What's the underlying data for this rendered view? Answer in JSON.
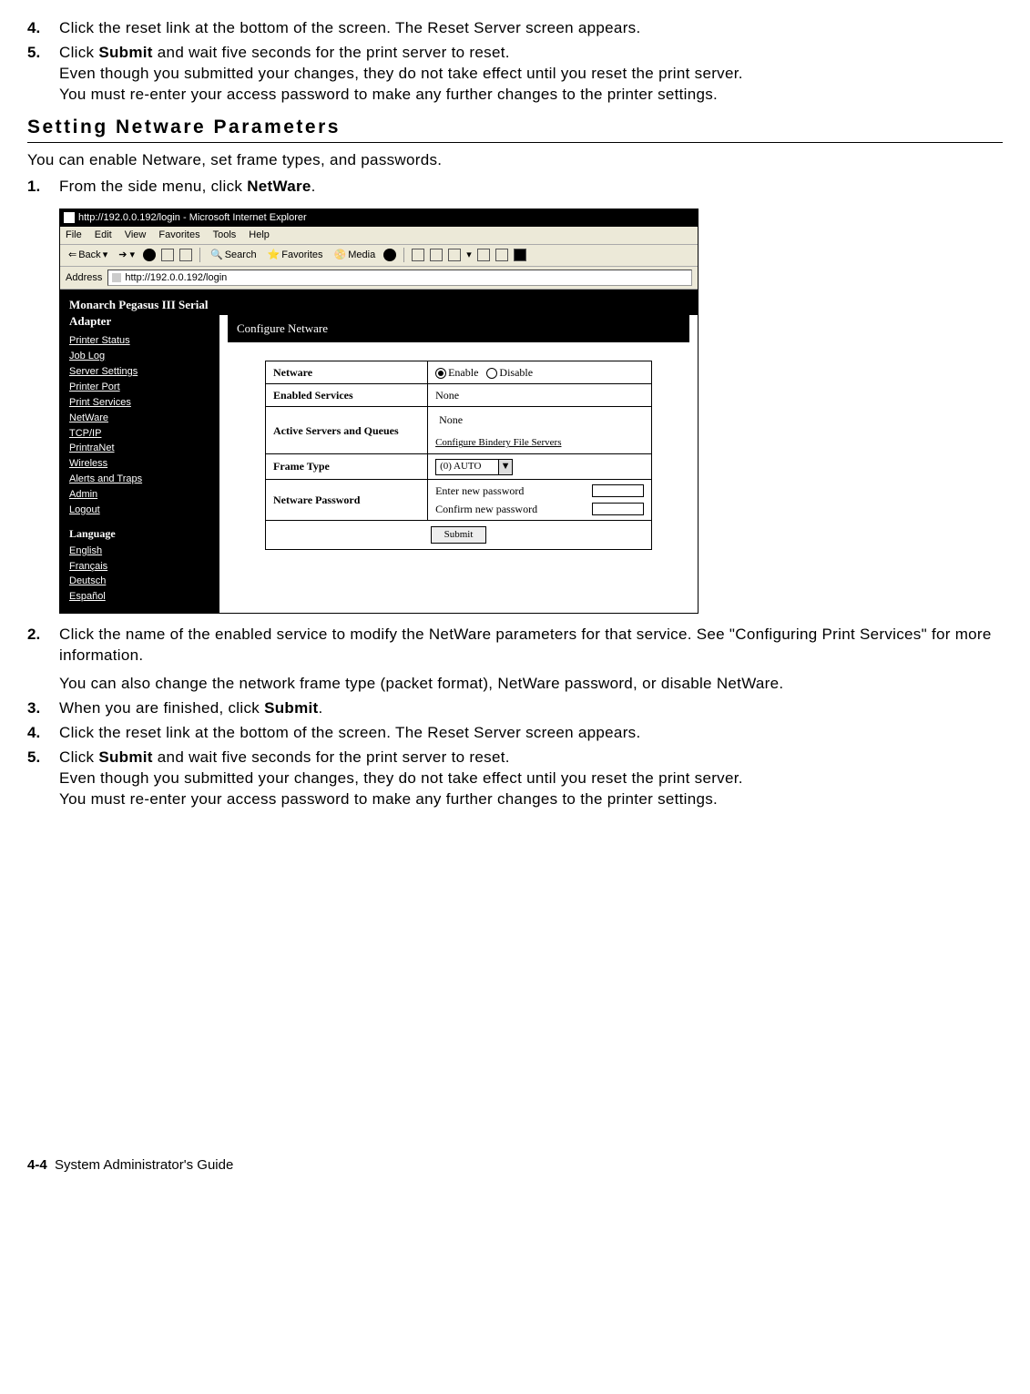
{
  "steps_top": [
    {
      "num": "4.",
      "text": "Click the reset link at the bottom of the screen.  The Reset Server screen appears."
    },
    {
      "num": "5.",
      "parts": [
        {
          "t": "Click "
        },
        {
          "t": "Submit",
          "bold": true
        },
        {
          "t": " and wait five seconds for the print server to reset.\nEven though you submitted your changes, they do not take effect until you reset the print server.\nYou must re-enter your access password to make any further changes to the printer settings."
        }
      ]
    }
  ],
  "section_heading": "Setting Netware Parameters",
  "section_intro": "You can enable Netware, set frame types, and passwords.",
  "steps_mid": [
    {
      "num": "1.",
      "parts": [
        {
          "t": "From the side menu, click "
        },
        {
          "t": "NetWare",
          "bold": true
        },
        {
          "t": "."
        }
      ]
    }
  ],
  "browser": {
    "title": "http://192.0.0.192/login - Microsoft Internet Explorer",
    "menu": [
      "File",
      "Edit",
      "View",
      "Favorites",
      "Tools",
      "Help"
    ],
    "toolbar": {
      "back": "Back",
      "search": "Search",
      "favorites": "Favorites",
      "media": "Media"
    },
    "address_label": "Address",
    "address_value": "http://192.0.0.192/login",
    "sidebar": {
      "title": "Monarch Pegasus III Serial Adapter",
      "links": [
        "Printer Status",
        "Job Log",
        "Server Settings",
        "Printer Port",
        "Print Services",
        "NetWare",
        "TCP/IP",
        "PrintraNet",
        "Wireless",
        "Alerts and Traps",
        "Admin",
        "Logout"
      ],
      "lang_header": "Language",
      "langs": [
        "English",
        "Français",
        "Deutsch",
        "Español"
      ]
    },
    "panel": {
      "header": "Configure Netware",
      "rows": {
        "netware": {
          "label": "Netware",
          "enable": "Enable",
          "disable": "Disable"
        },
        "enabled_services": {
          "label": "Enabled Services",
          "value": "None"
        },
        "active": {
          "label": "Active Servers and Queues",
          "value": "None",
          "link": "Configure Bindery File Servers"
        },
        "frame": {
          "label": "Frame Type",
          "value": "(0) AUTO"
        },
        "password": {
          "label": "Netware Password",
          "enter": "Enter new password",
          "confirm": "Confirm new password"
        },
        "submit": "Submit"
      }
    }
  },
  "steps_bottom": [
    {
      "num": "2.",
      "text": "Click the name of the enabled service to modify the NetWare parameters for that service.  See \"Configuring Print Services\" for more information.",
      "extra": "You can also change the network frame type (packet format), NetWare password, or disable NetWare."
    },
    {
      "num": "3.",
      "parts": [
        {
          "t": "When you are finished, click "
        },
        {
          "t": "Submit",
          "bold": true
        },
        {
          "t": "."
        }
      ]
    },
    {
      "num": "4.",
      "text": "Click the reset link at the bottom of the screen.  The Reset Server screen appears."
    },
    {
      "num": "5.",
      "parts": [
        {
          "t": "Click "
        },
        {
          "t": "Submit",
          "bold": true
        },
        {
          "t": " and wait five seconds for the print server to reset.\nEven though you submitted your changes, they do not take effect until you reset the print server.\nYou must re-enter your access password to make any further changes to the printer settings."
        }
      ]
    }
  ],
  "footer": {
    "page": "4-4",
    "title": "System Administrator's Guide"
  }
}
